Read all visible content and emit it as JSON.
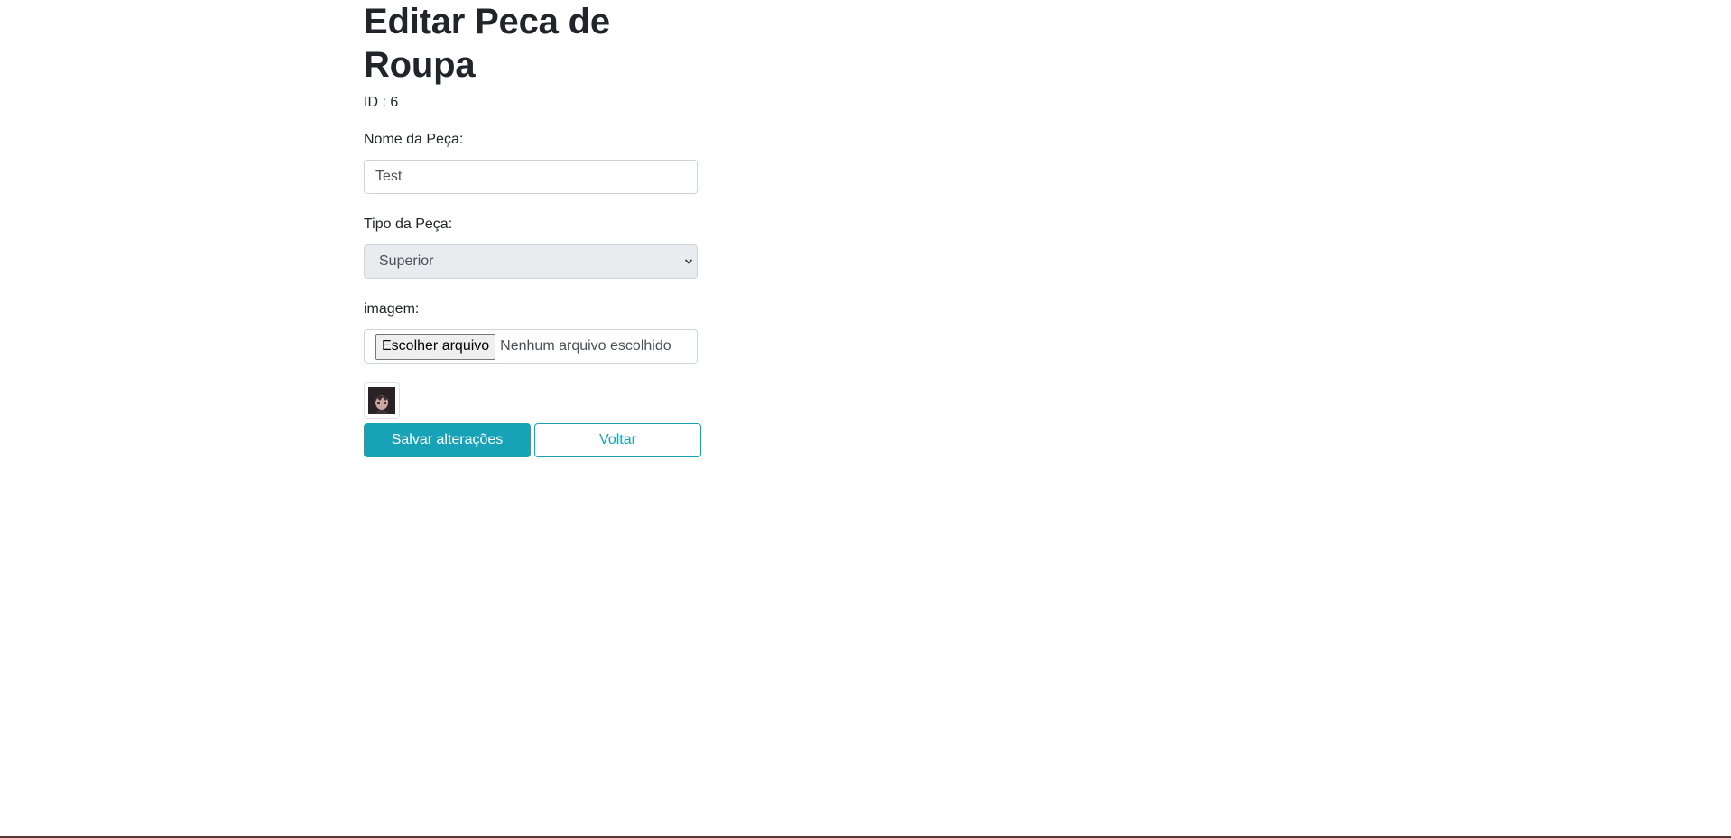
{
  "page": {
    "title": "Editar Peca de Roupa",
    "id_line": "ID : 6"
  },
  "form": {
    "nome_label": "Nome da Peça:",
    "nome_value": "Test",
    "tipo_label": "Tipo da Peça:",
    "tipo_selected": "Superior",
    "imagem_label": "imagem:",
    "file_button_label": "Escolher arquivo",
    "file_status": "Nenhum arquivo escolhido",
    "thumbnail_icon": "avatar-thumbnail"
  },
  "actions": {
    "save_label": "Salvar alterações",
    "back_label": "Voltar"
  },
  "colors": {
    "accent": "#17a2b8",
    "select_bg": "#e9ecef"
  }
}
